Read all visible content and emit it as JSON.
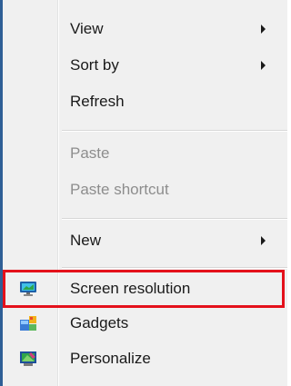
{
  "menu": {
    "items": [
      {
        "label": "View",
        "has_submenu": true,
        "enabled": true
      },
      {
        "label": "Sort by",
        "has_submenu": true,
        "enabled": true
      },
      {
        "label": "Refresh",
        "has_submenu": false,
        "enabled": true
      },
      {
        "label": "Paste",
        "has_submenu": false,
        "enabled": false
      },
      {
        "label": "Paste shortcut",
        "has_submenu": false,
        "enabled": false
      },
      {
        "label": "New",
        "has_submenu": true,
        "enabled": true
      },
      {
        "label": "Screen resolution",
        "has_submenu": false,
        "enabled": true,
        "icon": "monitor-icon",
        "highlighted": true
      },
      {
        "label": "Gadgets",
        "has_submenu": false,
        "enabled": true,
        "icon": "gadgets-icon"
      },
      {
        "label": "Personalize",
        "has_submenu": false,
        "enabled": true,
        "icon": "personalize-icon"
      }
    ]
  },
  "colors": {
    "highlight_border": "#e4111b",
    "menu_background": "#f0f0f0",
    "disabled_text": "#8d8d8d"
  }
}
